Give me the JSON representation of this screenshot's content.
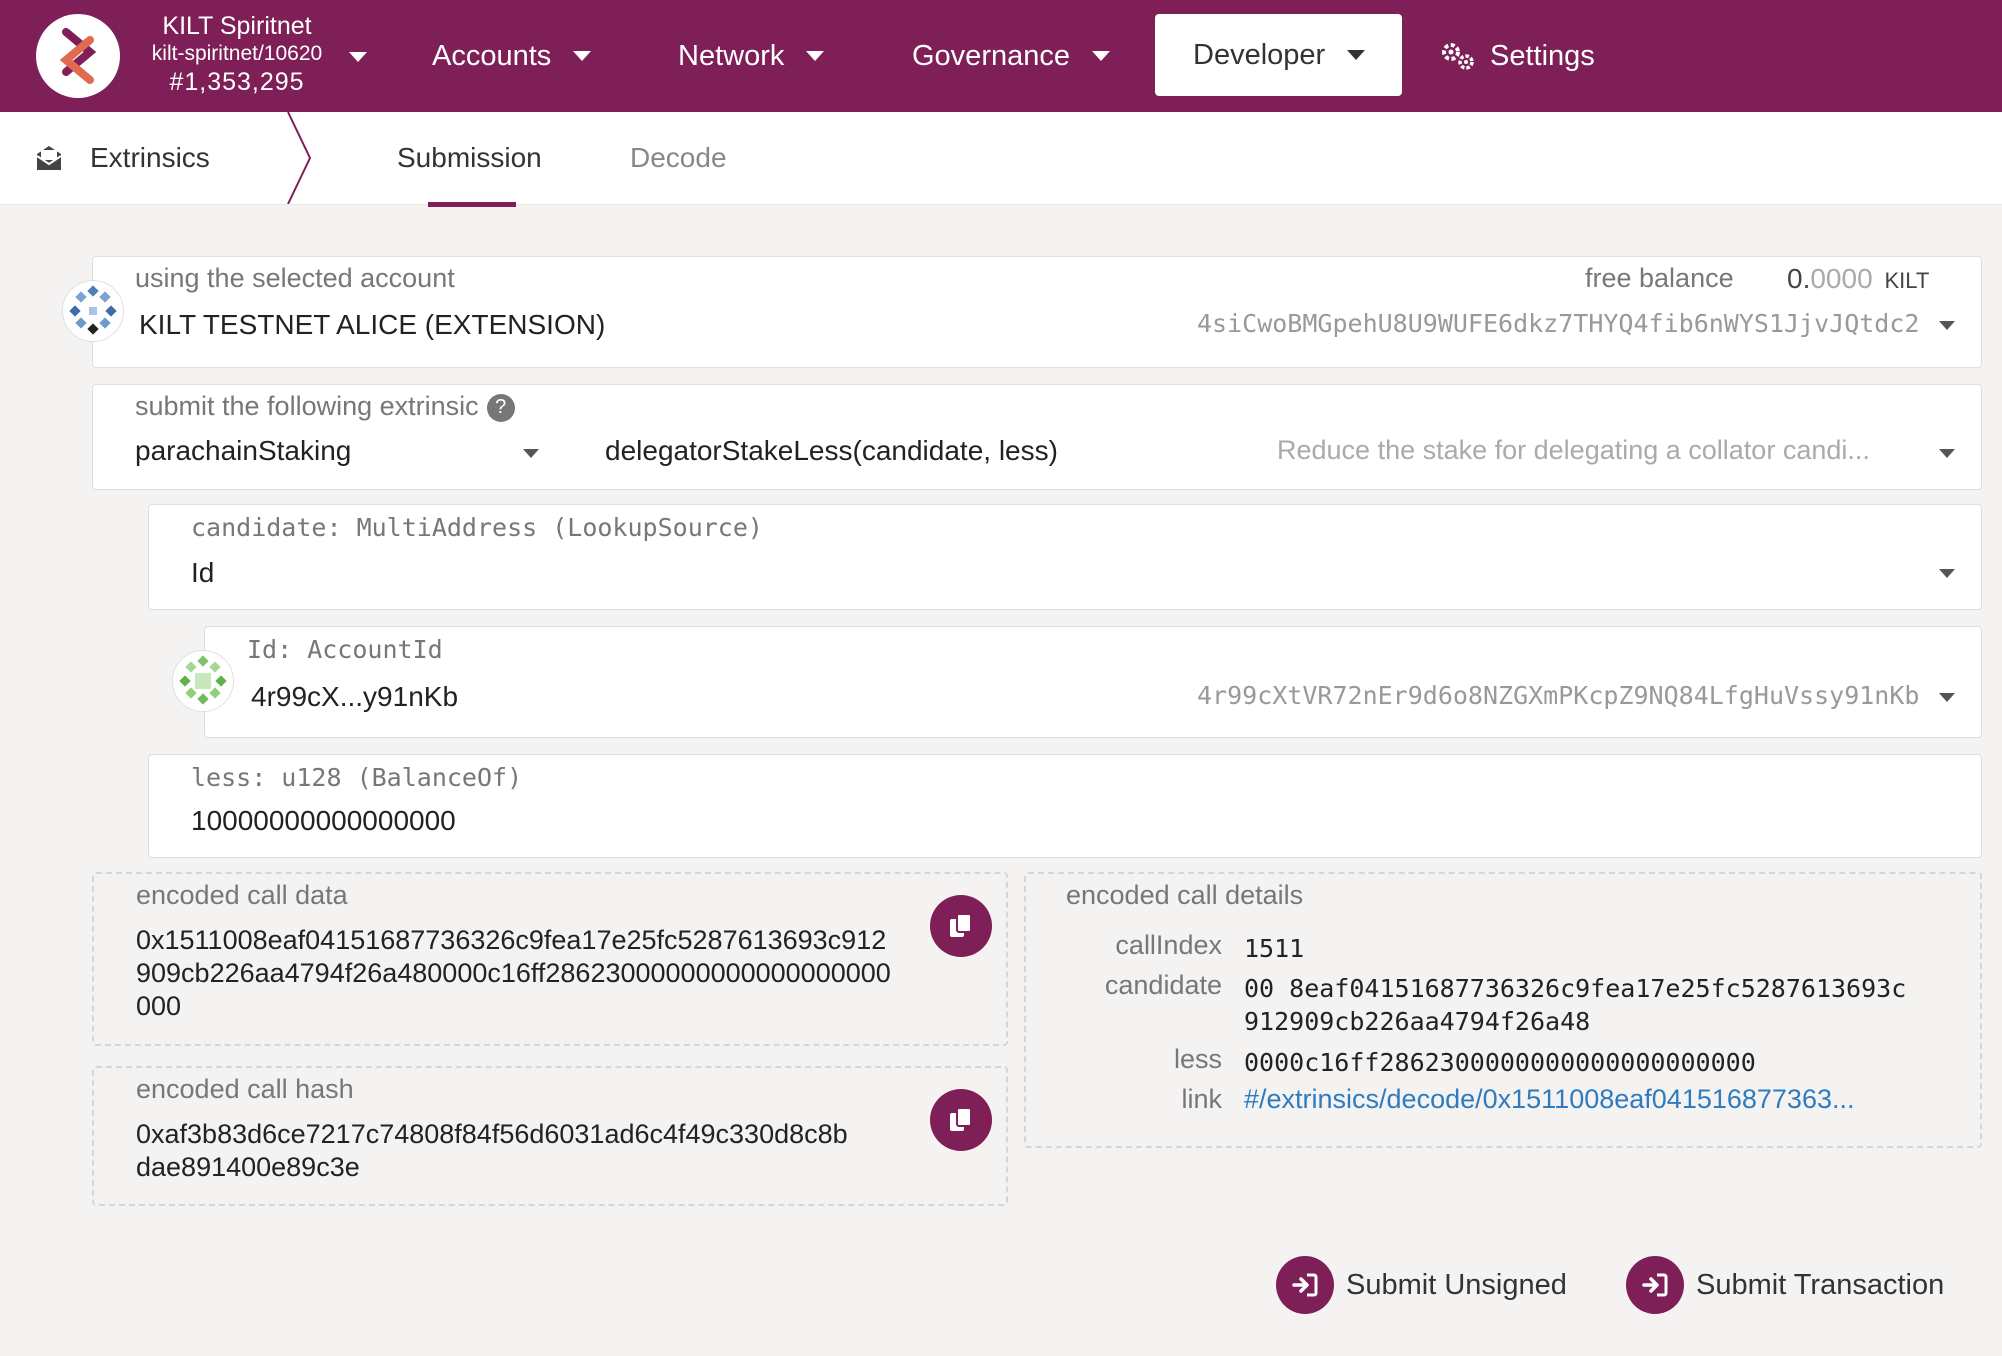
{
  "header": {
    "chain_name": "KILT Spiritnet",
    "chain_version": "kilt-spiritnet/10620",
    "block_number": "#1,353,295",
    "menu": {
      "accounts": "Accounts",
      "network": "Network",
      "governance": "Governance",
      "developer": "Developer",
      "settings": "Settings"
    }
  },
  "tabs": {
    "section": "Extrinsics",
    "submission": "Submission",
    "decode": "Decode"
  },
  "account": {
    "label": "using the selected account",
    "name": "KILT TESTNET ALICE (EXTENSION)",
    "balance_label": "free balance",
    "balance_int": "0.",
    "balance_frac": "0000",
    "balance_unit": "KILT",
    "address": "4siCwoBMGpehU8U9WUFE6dkz7THYQ4fib6nWYS1JjvJQtdc2"
  },
  "extrinsic": {
    "label": "submit the following extrinsic",
    "pallet": "parachainStaking",
    "method": "delegatorStakeLess(candidate, less)",
    "description": "Reduce the stake for delegating a collator candi..."
  },
  "candidate": {
    "label": "candidate: MultiAddress (LookupSource)",
    "value": "Id"
  },
  "id_param": {
    "label": "Id: AccountId",
    "short": "4r99cX...y91nKb",
    "address": "4r99cXtVR72nEr9d6o8NZGXmPKcpZ9NQ84LfgHuVssy91nKb"
  },
  "less": {
    "label": "less: u128 (BalanceOf)",
    "value": "10000000000000000"
  },
  "encoded_call_data": {
    "label": "encoded call data",
    "line1": "0x1511008eaf04151687736326c9fea17e25fc5287613693c912",
    "line2": "909cb226aa4794f26a480000c16ff28623000000000000000000",
    "line3": "000"
  },
  "encoded_call_hash": {
    "label": "encoded call hash",
    "line1": "0xaf3b83d6ce7217c74808f84f56d6031ad6c4f49c330d8c8b",
    "line2": "dae891400e89c3e"
  },
  "encoded_call_details": {
    "label": "encoded call details",
    "call_index_key": "callIndex",
    "call_index_val": "1511",
    "candidate_key": "candidate",
    "candidate_val1": "00 8eaf04151687736326c9fea17e25fc5287613693c",
    "candidate_val2": "912909cb226aa4794f26a48",
    "less_key": "less",
    "less_val": "0000c16ff2862300000000000000000000",
    "link_key": "link",
    "link_val": "#/extrinsics/decode/0x1511008eaf041516877363..."
  },
  "actions": {
    "submit_unsigned": "Submit Unsigned",
    "submit_transaction": "Submit Transaction"
  },
  "colors": {
    "brand": "#7e1f57",
    "link": "#2f7bbf"
  }
}
